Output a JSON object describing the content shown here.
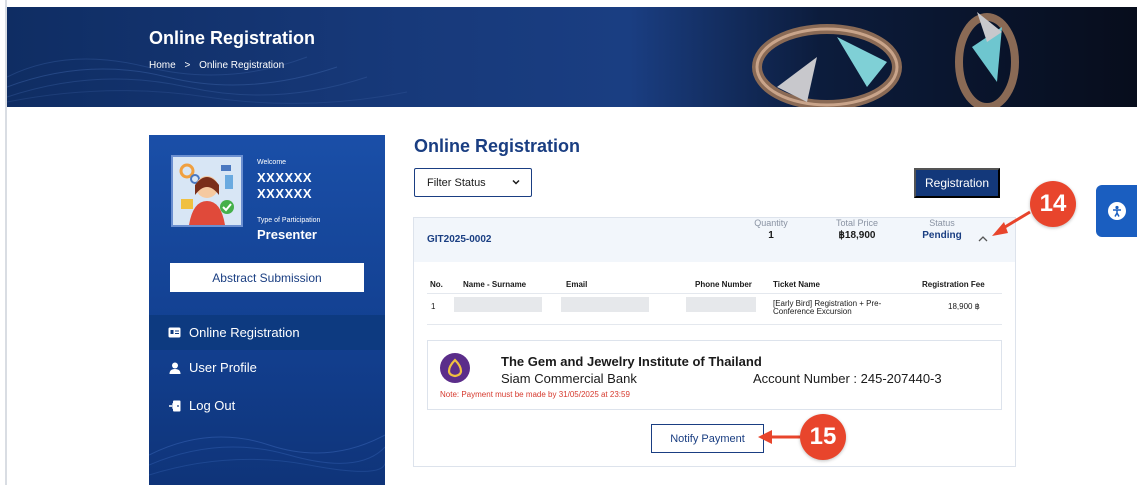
{
  "banner": {
    "title": "Online Registration",
    "breadcrumb_home": "Home",
    "breadcrumb_sep": ">",
    "breadcrumb_current": "Online Registration"
  },
  "sidebar": {
    "welcome": "Welcome",
    "name_line1": "XXXXXX",
    "name_line2": "XXXXXX",
    "type_label": "Type of Participation",
    "type_value": "Presenter",
    "abstract_button": "Abstract Submission",
    "items": [
      {
        "label": "Online Registration",
        "icon": "id-card-icon",
        "active": true
      },
      {
        "label": "User Profile",
        "icon": "user-icon",
        "active": false
      },
      {
        "label": "Log Out",
        "icon": "logout-icon",
        "active": false
      }
    ]
  },
  "main": {
    "title": "Online Registration",
    "filter_label": "Filter Status",
    "registration_button": "Registration"
  },
  "order": {
    "id": "GIT2025-0002",
    "quantity_label": "Quantity",
    "quantity_value": "1",
    "total_label": "Total Price",
    "total_value": "฿18,900",
    "status_label": "Status",
    "status_value": "Pending"
  },
  "table": {
    "headers": [
      "No.",
      "Name - Surname",
      "Email",
      "Phone Number",
      "Ticket Name",
      "Registration Fee"
    ],
    "rows": [
      {
        "no": "1",
        "ticket": "[Early Bird] Registration + Pre-Conference Excursion",
        "fee": "18,900 ฿"
      }
    ]
  },
  "payment": {
    "org": "The Gem and Jewelry Institute of Thailand",
    "bank": "Siam Commercial Bank",
    "account": "Account Number : 245-207440-3",
    "note": "Note: Payment must be made by 31/05/2025 at 23:59",
    "notify_button": "Notify Payment"
  },
  "callouts": {
    "first": "14",
    "second": "15"
  },
  "colors": {
    "brand_navy": "#1a3e82",
    "sidebar_blue": "#1a4fa8",
    "callout_red": "#e8452c",
    "note_red": "#d63a2e"
  }
}
